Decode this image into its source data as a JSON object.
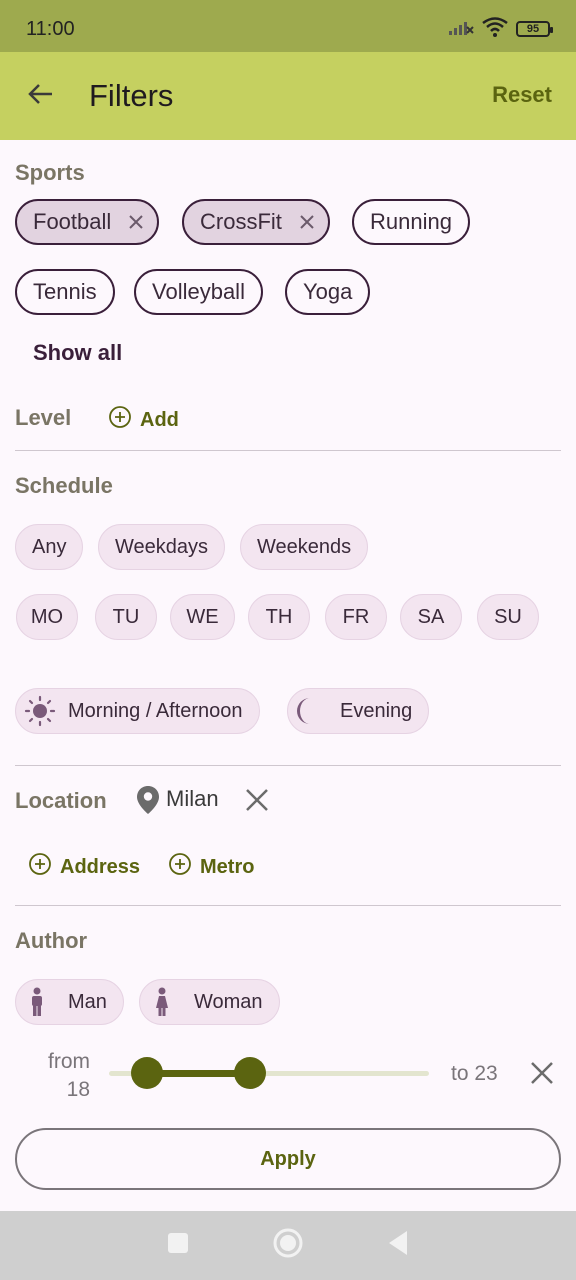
{
  "status": {
    "time": "11:00",
    "battery": "95"
  },
  "appbar": {
    "title": "Filters",
    "reset_label": "Reset"
  },
  "sports": {
    "title": "Sports",
    "selected": [
      "Football",
      "CrossFit"
    ],
    "options": [
      "Running",
      "Tennis",
      "Volleyball",
      "Yoga"
    ],
    "show_all": "Show all"
  },
  "level": {
    "title": "Level",
    "add_label": "Add"
  },
  "schedule": {
    "title": "Schedule",
    "periods": [
      "Any",
      "Weekdays",
      "Weekends"
    ],
    "days": [
      "MO",
      "TU",
      "WE",
      "TH",
      "FR",
      "SA",
      "SU"
    ],
    "times": [
      "Morning / Afternoon",
      "Evening"
    ]
  },
  "location": {
    "title": "Location",
    "value": "Milan",
    "address_label": "Address",
    "metro_label": "Metro"
  },
  "author": {
    "title": "Author",
    "genders": [
      "Man",
      "Woman"
    ],
    "age_from_label": "from",
    "age_from": "18",
    "age_to_label": "to 23",
    "age_range_fraction": [
      0.12,
      0.44
    ]
  },
  "apply_label": "Apply",
  "colors": {
    "accent": "#5b6410",
    "appbar": "#c5d060",
    "statusbar": "#9eaa4e",
    "chip_tonal": "#f3e5f0"
  }
}
